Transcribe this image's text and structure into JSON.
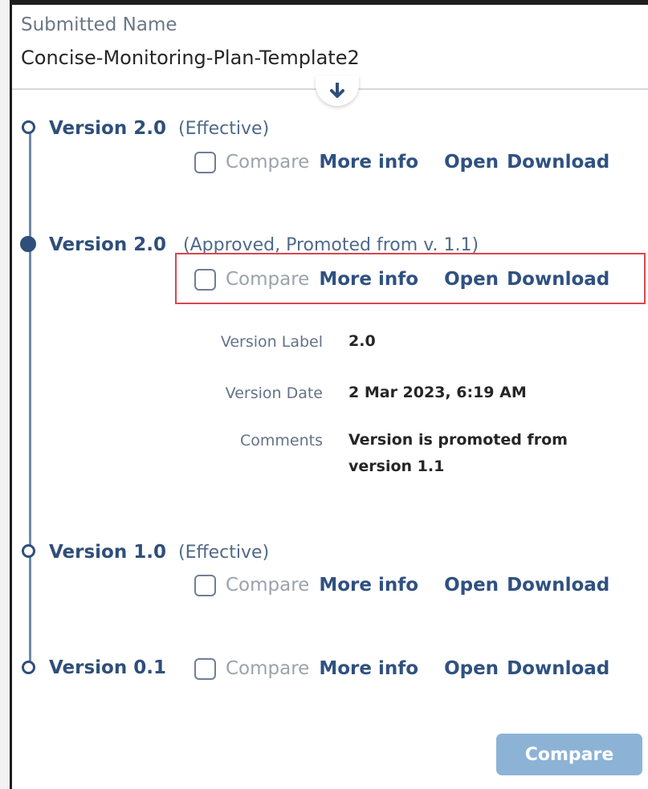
{
  "submitted": {
    "label": "Submitted Name",
    "value": "Concise-Monitoring-Plan-Template2"
  },
  "actions": {
    "compare_label": "Compare",
    "more_info": "More info",
    "open": "Open",
    "download": "Download"
  },
  "versions": [
    {
      "name": "Version 2.0",
      "status": "(Effective)"
    },
    {
      "name": "Version 2.0",
      "status": "(Approved, Promoted from v. 1.1)"
    },
    {
      "name": "Version 1.0",
      "status": "(Effective)"
    },
    {
      "name": "Version 0.1",
      "status": ""
    }
  ],
  "details": {
    "version_label": {
      "label": "Version Label",
      "value": "2.0"
    },
    "version_date": {
      "label": "Version Date",
      "value": "2 Mar 2023, 6:19 AM"
    },
    "comments": {
      "label": "Comments",
      "line1": "Version is promoted from",
      "line2": "version 1.1"
    }
  },
  "footer": {
    "compare_button": "Compare"
  },
  "icons": {
    "scroll": "arrow-down-icon"
  },
  "colors": {
    "accent": "#2f4f7a",
    "button": "#8cb3d6",
    "highlight": "#d6484f"
  }
}
